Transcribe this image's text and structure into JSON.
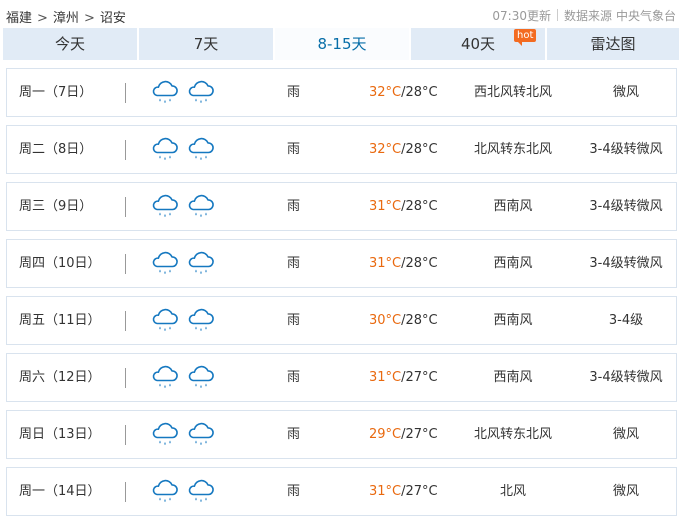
{
  "breadcrumb": {
    "items": [
      "福建",
      "漳州",
      "诏安"
    ],
    "separator": ">"
  },
  "meta": {
    "updated": "07:30更新",
    "source_label": "数据来源",
    "source_org": "中央气象台"
  },
  "tabs": [
    {
      "label": "今天",
      "active": false
    },
    {
      "label": "7天",
      "active": false
    },
    {
      "label": "8-15天",
      "active": true
    },
    {
      "label": "40天",
      "active": false,
      "badge": "hot"
    },
    {
      "label": "雷达图",
      "active": false
    }
  ],
  "colors": {
    "tab_bg": "#e1ebf6",
    "tab_active_text": "#076ea8",
    "high_temp": "#e9690f",
    "hot_badge": "#f36b21",
    "rain_icon": "#1578c0"
  },
  "forecast": [
    {
      "day": "周一（7日）",
      "icons": [
        "rain-cloud-icon",
        "rain-cloud-icon"
      ],
      "weather": "雨",
      "high": "32°C",
      "low": "/28°C",
      "wind_dir": "西北风转北风",
      "wind_level": "微风"
    },
    {
      "day": "周二（8日）",
      "icons": [
        "rain-cloud-icon",
        "rain-cloud-icon"
      ],
      "weather": "雨",
      "high": "32°C",
      "low": "/28°C",
      "wind_dir": "北风转东北风",
      "wind_level": "3-4级转微风"
    },
    {
      "day": "周三（9日）",
      "icons": [
        "rain-cloud-icon",
        "rain-cloud-icon"
      ],
      "weather": "雨",
      "high": "31°C",
      "low": "/28°C",
      "wind_dir": "西南风",
      "wind_level": "3-4级转微风"
    },
    {
      "day": "周四（10日）",
      "icons": [
        "rain-cloud-icon",
        "rain-cloud-icon"
      ],
      "weather": "雨",
      "high": "31°C",
      "low": "/28°C",
      "wind_dir": "西南风",
      "wind_level": "3-4级转微风"
    },
    {
      "day": "周五（11日）",
      "icons": [
        "rain-cloud-icon",
        "rain-cloud-icon"
      ],
      "weather": "雨",
      "high": "30°C",
      "low": "/28°C",
      "wind_dir": "西南风",
      "wind_level": "3-4级"
    },
    {
      "day": "周六（12日）",
      "icons": [
        "rain-cloud-icon",
        "rain-cloud-icon"
      ],
      "weather": "雨",
      "high": "31°C",
      "low": "/27°C",
      "wind_dir": "西南风",
      "wind_level": "3-4级转微风"
    },
    {
      "day": "周日（13日）",
      "icons": [
        "rain-cloud-icon",
        "rain-cloud-icon"
      ],
      "weather": "雨",
      "high": "29°C",
      "low": "/27°C",
      "wind_dir": "北风转东北风",
      "wind_level": "微风"
    },
    {
      "day": "周一（14日）",
      "icons": [
        "rain-cloud-icon",
        "rain-cloud-icon"
      ],
      "weather": "雨",
      "high": "31°C",
      "low": "/27°C",
      "wind_dir": "北风",
      "wind_level": "微风"
    }
  ]
}
